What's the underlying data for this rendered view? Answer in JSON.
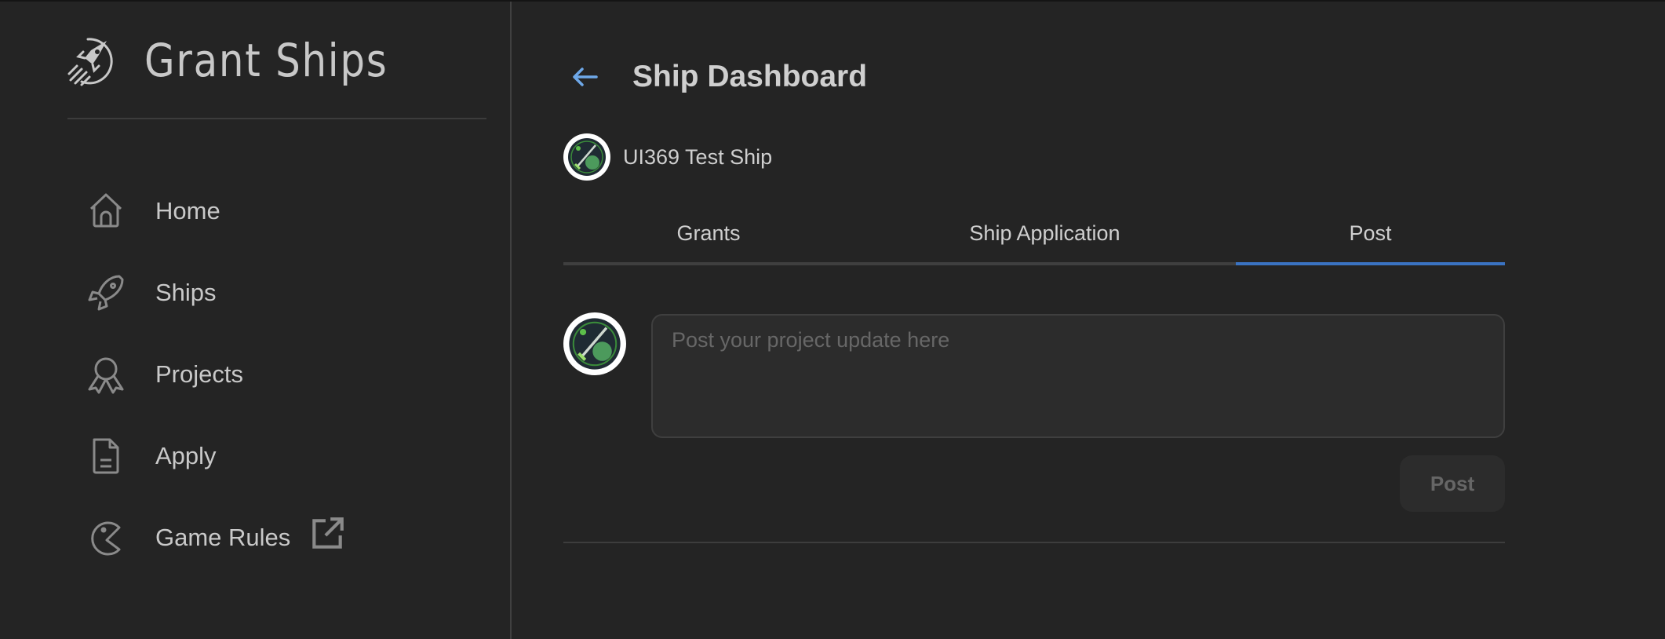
{
  "brand": {
    "name": "Grant Ships",
    "logo_icon": "rocket-logo-icon"
  },
  "sidebar": {
    "items": [
      {
        "label": "Home",
        "icon": "home-icon"
      },
      {
        "label": "Ships",
        "icon": "rocket-icon"
      },
      {
        "label": "Projects",
        "icon": "award-icon"
      },
      {
        "label": "Apply",
        "icon": "file-text-icon"
      },
      {
        "label": "Game Rules",
        "icon": "pacman-icon",
        "external": true
      }
    ]
  },
  "header": {
    "title": "Ship Dashboard",
    "back_icon": "arrow-left-icon"
  },
  "ship": {
    "name": "UI369 Test Ship"
  },
  "tabs": [
    {
      "label": "Grants",
      "active": false
    },
    {
      "label": "Ship Application",
      "active": false
    },
    {
      "label": "Post",
      "active": true
    }
  ],
  "post": {
    "placeholder": "Post your project update here",
    "value": "",
    "submit_label": "Post"
  },
  "colors": {
    "accent": "#3a73c2",
    "back_arrow": "#6ea8e8",
    "background": "#242424"
  }
}
